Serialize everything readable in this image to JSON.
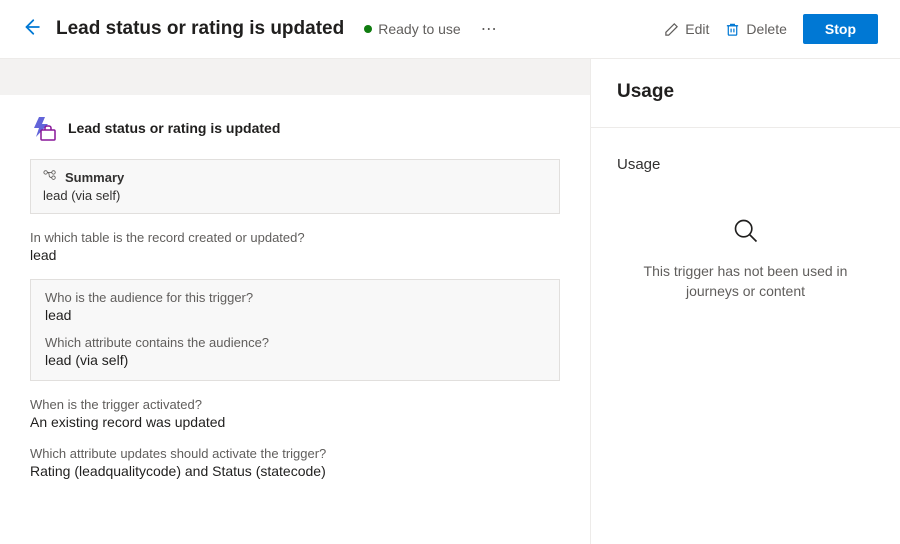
{
  "header": {
    "title": "Lead status or rating is updated",
    "status": "Ready to use",
    "edit_label": "Edit",
    "delete_label": "Delete",
    "stop_label": "Stop"
  },
  "trigger": {
    "title": "Lead status or rating is updated",
    "summary_label": "Summary",
    "summary_value": "lead (via self)",
    "table_label": "In which table is the record created or updated?",
    "table_value": "lead",
    "audience_label": "Who is the audience for this trigger?",
    "audience_value": "lead",
    "audience_attr_label": "Which attribute contains the audience?",
    "audience_attr_value": "lead (via self)",
    "activated_label": "When is the trigger activated?",
    "activated_value": "An existing record was updated",
    "updates_label": "Which attribute updates should activate the trigger?",
    "updates_value": "Rating (leadqualitycode) and Status (statecode)"
  },
  "usage": {
    "heading": "Usage",
    "sub_heading": "Usage",
    "empty_text": "This trigger has not been used in journeys or content"
  }
}
